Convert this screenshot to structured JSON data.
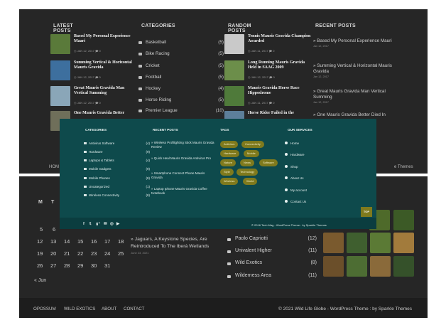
{
  "top": {
    "latest_posts": {
      "heading": "LATEST POSTS",
      "posts": [
        {
          "title": "Based My Personal Experience Maari",
          "meta": "◷ JAN 12, 2017   🗩 0",
          "color": "#5a7a3a"
        },
        {
          "title": "Summing Vertical & Horizontal Mauris Gravida",
          "meta": "◷ JAN 12, 2017   🗩 0",
          "color": "#3d6f9e"
        },
        {
          "title": "Great Mauris Gravida Man Vertical Summing",
          "meta": "◷ JAN 12, 2017   🗩 0",
          "color": "#8aa6b8"
        },
        {
          "title": "One Mauris Gravida Better",
          "meta": "",
          "color": "#6f6f5a"
        }
      ]
    },
    "categories": {
      "heading": "CATEGORIES",
      "items": [
        {
          "name": "Basketball",
          "count": "(5)"
        },
        {
          "name": "Bike Racing",
          "count": "(5)"
        },
        {
          "name": "Cricket",
          "count": "(5)"
        },
        {
          "name": "Football",
          "count": "(5)"
        },
        {
          "name": "Hockey",
          "count": "(4)"
        },
        {
          "name": "Horse Riding",
          "count": "(5)"
        },
        {
          "name": "Premier League",
          "count": "(10)"
        }
      ]
    },
    "random_posts": {
      "heading": "RANDOM POSTS",
      "posts": [
        {
          "title": "Tennis Mauris Gravida Champion Awarded",
          "meta": "◷ JAN 11, 2017   🗩 0",
          "color": "#c9c9c9"
        },
        {
          "title": "Long Running Mauris Gravida Held in SAAG 2009",
          "meta": "◷ JAN 12, 2017   🗩 0",
          "color": "#6c8e4a"
        },
        {
          "title": "Mauris Gravida Horse Race Hippodrome",
          "meta": "◷ JAN 11, 2017   🗩 0",
          "color": "#4f7a3a"
        },
        {
          "title": "Horse Rider Failed in the",
          "meta": "",
          "color": "#5d7f9a"
        }
      ]
    },
    "recent_posts": {
      "heading": "RECENT POSTS",
      "items": [
        {
          "title": "» Based My Personal Experience Mauri",
          "date": "Jan 12, 2017"
        },
        {
          "title": "» Summing Vertical & Horizontal Mauris Gravida",
          "date": "Jan 12, 2017"
        },
        {
          "title": "» Great Mauris Gravida Man Vertical Summing",
          "date": "Jan 12, 2017"
        },
        {
          "title": "» One Mauris Gravida Better Died In",
          "date": ""
        }
      ]
    },
    "nav_peek": "HOM",
    "themes_peek": "e Themes"
  },
  "teal": {
    "categories": {
      "heading": "CATEGORIES",
      "items": [
        {
          "name": "Antivirus Software",
          "count": "(4)"
        },
        {
          "name": "Hardware",
          "count": "(9)"
        },
        {
          "name": "Laptops & Tablets",
          "count": "(4)"
        },
        {
          "name": "Mobile Gadgets",
          "count": "(9)"
        },
        {
          "name": "Mobile Phones",
          "count": "(8)"
        },
        {
          "name": "Uncategorized",
          "count": "(1)"
        },
        {
          "name": "Wireless Connectivity",
          "count": "(8)"
        }
      ]
    },
    "recent_posts": {
      "heading": "RECENT POSTS",
      "items": [
        "» Wireless Profilighting Stick Mauris Gravida Review",
        "» Quick Heal Mauris Gravida Antivirus Pro",
        "» Smartphone Connect Phone Mauris Gravida",
        "» Laptop Iphone Mauris Gravida Coffee Notebook"
      ]
    },
    "tags": {
      "heading": "TAGS",
      "items": [
        "Antivirus",
        "Connectivity",
        "Hardware",
        "Mobile",
        "Nature",
        "News",
        "Software",
        "Style",
        "Technology",
        "Wireless",
        "World"
      ]
    },
    "services": {
      "heading": "OUR SERVICES",
      "items": [
        "Home",
        "Hardware",
        "Shop",
        "About Us",
        "My account",
        "Contact Us"
      ]
    },
    "social": [
      "f",
      "𝕥",
      "g⁺",
      "✉",
      "◎",
      "▶"
    ],
    "copyright": "© 2016 Tech Mag - WordPress Theme : by Sparkle Themes",
    "top_button": "TOP"
  },
  "bottom": {
    "calendar": {
      "headers": [
        "M",
        "T"
      ],
      "rows": [
        [
          "5",
          "6"
        ],
        [
          "12",
          "13",
          "14",
          "15",
          "16",
          "17",
          "18"
        ],
        [
          "19",
          "20",
          "21",
          "22",
          "23",
          "24",
          "25"
        ],
        [
          "26",
          "27",
          "28",
          "29",
          "30",
          "31"
        ]
      ],
      "prev": "« Jun"
    },
    "post": {
      "title": "» Jaguars, A Keystone Species, Are Reintroduced To The Iberá Wetlands",
      "date": "June 23, 2021"
    },
    "categories": [
      {
        "name": "Paolo Capriotti",
        "count": "(12)"
      },
      {
        "name": "Univalent Higher",
        "count": "(11)"
      },
      {
        "name": "Wild Exotics",
        "count": "(8)"
      },
      {
        "name": "Wilderness Area",
        "count": "(11)"
      }
    ],
    "gallery_colors": [
      "#4e6a2a",
      "#7a5a2e",
      "#3f5f2f",
      "#5b7a35",
      "#a27b3c",
      "#3c5a26",
      "#6b4f2a",
      "#4d6d33",
      "#8a6a3a",
      "#35512a",
      "#6e7f3a",
      "#5a4630"
    ],
    "nav": [
      "OPOSSUM",
      "WILD EXOTICS",
      "ABOUT",
      "CONTACT"
    ],
    "copyright": "© 2021 Wild Life Globe - WordPress Theme : by Sparkle Themes"
  }
}
